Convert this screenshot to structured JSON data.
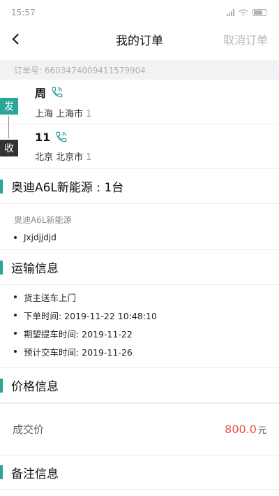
{
  "status_bar": {
    "time": "15:57"
  },
  "nav": {
    "back_glyph": "‹",
    "title": "我的订单",
    "cancel_label": "取消订单"
  },
  "order": {
    "number_text": "订单号:  6603474009411579904"
  },
  "route": {
    "send_tag": "发",
    "recv_tag": "收",
    "sender": {
      "name": "周",
      "address": "上海 上海市",
      "address_num": "1"
    },
    "receiver": {
      "name": "11",
      "address": "北京 北京市",
      "address_num": "1"
    }
  },
  "vehicle": {
    "heading": "奥迪A6L新能源 : 1台",
    "model": "奥迪A6L新能源",
    "items": [
      "Jxjdjjdjd"
    ]
  },
  "transport": {
    "heading": "运输信息",
    "items": [
      "货主送车上门",
      "下单时间: 2019-11-22 10:48:10",
      "期望提车时间: 2019-11-22",
      "预计交车时间: 2019-11-26"
    ]
  },
  "price": {
    "heading": "价格信息",
    "label": "成交价",
    "value": "800.0",
    "unit": "元"
  },
  "remark": {
    "heading": "备注信息"
  },
  "colors": {
    "accent": "#2aa597",
    "price": "#e9533f",
    "recv_tag": "#333333"
  },
  "icons": [
    "back-chevron-icon",
    "phone-icon",
    "signal-icon",
    "wifi-icon",
    "battery-icon"
  ]
}
